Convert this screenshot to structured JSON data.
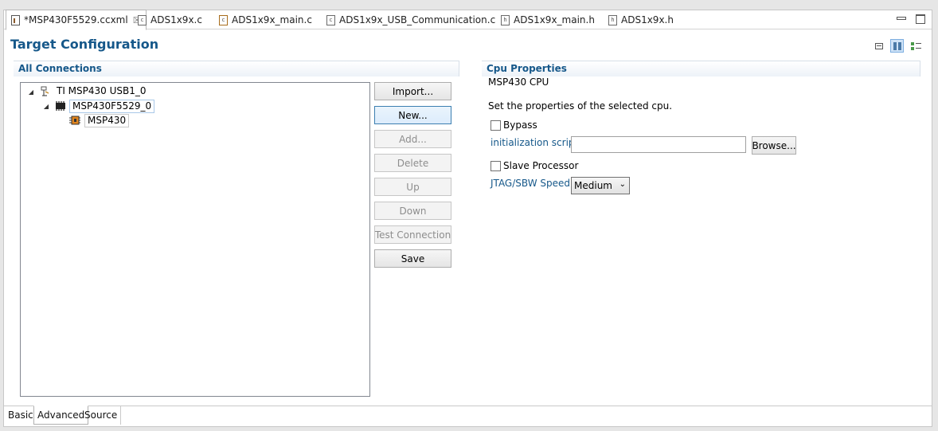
{
  "editor_tabs": [
    {
      "label": "*MSP430F5529.ccxml",
      "icon": "target-config-file-icon",
      "active": true,
      "closable": true
    },
    {
      "label": "ADS1x9x.c",
      "icon": "c-file-icon"
    },
    {
      "label": "ADS1x9x_main.c",
      "icon": "c-file-warning-icon"
    },
    {
      "label": "ADS1x9x_USB_Communication.c",
      "icon": "c-file-icon"
    },
    {
      "label": "ADS1x9x_main.h",
      "icon": "h-file-icon"
    },
    {
      "label": "ADS1x9x.h",
      "icon": "h-file-icon"
    }
  ],
  "tab_close_glyph": "☒",
  "page_title": "Target Configuration",
  "left_section": {
    "title": "All Connections",
    "tree": [
      {
        "label": "TI MSP430 USB1_0",
        "icon": "usb-probe-icon",
        "expanded": true,
        "twisty": "◢"
      },
      {
        "label": "MSP430F5529_0",
        "icon": "chip-icon",
        "expanded": true,
        "twisty": "◢",
        "selected": true
      },
      {
        "label": "MSP430",
        "icon": "cpu-icon"
      }
    ]
  },
  "buttons": {
    "import": "Import...",
    "new": "New...",
    "add": "Add...",
    "delete": "Delete",
    "up": "Up",
    "down": "Down",
    "test_connection": "Test Connection",
    "save": "Save"
  },
  "right_section": {
    "title": "Cpu Properties",
    "cpu_name": "MSP430 CPU",
    "description": "Set the properties of the selected cpu.",
    "bypass_label": "Bypass",
    "bypass_checked": false,
    "init_script_label": "initialization script",
    "init_script_value": "",
    "browse_label": "Browse...",
    "slave_processor_label": "Slave Processor",
    "slave_processor_checked": false,
    "jtag_speed_label": "JTAG/SBW Speed",
    "jtag_speed_value": "Medium",
    "select_arrow": "⌄"
  },
  "bottom_tabs": [
    {
      "label": "Basic"
    },
    {
      "label": "Advanced",
      "active": true
    },
    {
      "label": "Source"
    }
  ],
  "colors": {
    "title_blue": "#16588a",
    "link_blue": "#16588a",
    "disabled_text": "#8d8d8d"
  }
}
